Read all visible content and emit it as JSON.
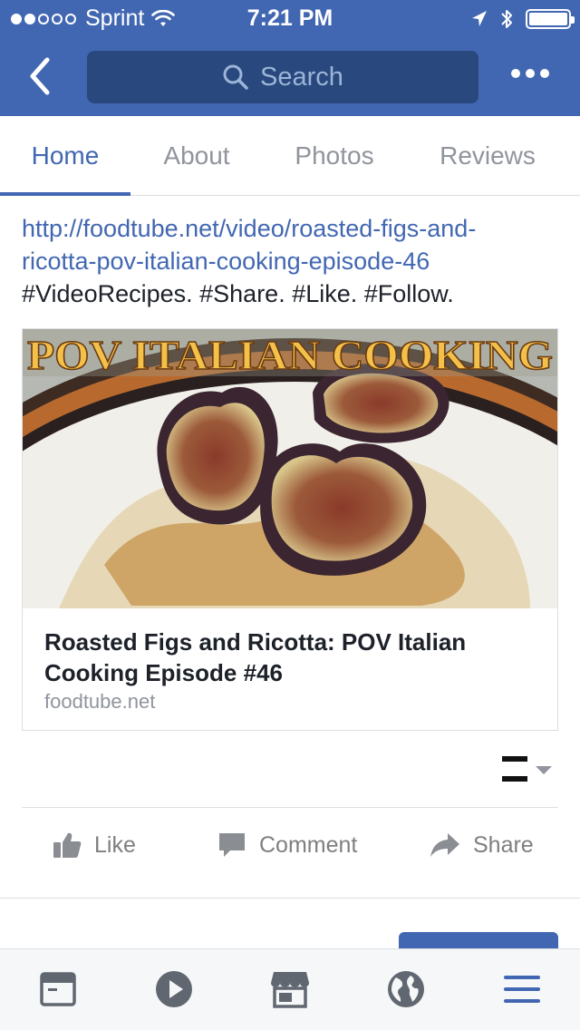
{
  "status_bar": {
    "carrier": "Sprint",
    "time": "7:21 PM",
    "signal_bars_filled": 2,
    "signal_bars_total": 5
  },
  "header": {
    "search_placeholder": "Search",
    "icons": [
      "back-arrow-icon",
      "search-icon",
      "more-dots-icon"
    ],
    "bar_color": "#4267b2",
    "search_bg_color": "#29487d"
  },
  "tabs": [
    {
      "label": "Home",
      "active": true
    },
    {
      "label": "About",
      "active": false
    },
    {
      "label": "Photos",
      "active": false
    },
    {
      "label": "Reviews",
      "active": false
    }
  ],
  "post": {
    "link_line1": "http://foodtube.net/video/roasted-figs-and-",
    "link_line2": "ricotta-pov-italian-cooking-episode-46",
    "tags": "#VideoRecipes. #Share. #Like. #Follow.",
    "card": {
      "image_banner": "POV ITALIAN COOKING",
      "title": "Roasted Figs and Ricotta: POV Italian Cooking Episode #46",
      "domain": "foodtube.net"
    },
    "actions": [
      {
        "label": "Like",
        "icon": "thumbs-up-icon"
      },
      {
        "label": "Comment",
        "icon": "comment-icon"
      },
      {
        "label": "Share",
        "icon": "share-arrow-icon"
      }
    ]
  },
  "bottom_nav": {
    "items": [
      "news-feed-icon",
      "video-play-icon",
      "marketplace-icon",
      "globe-icon",
      "menu-icon"
    ],
    "active_color": "#4267b2",
    "inactive_color": "#606770"
  },
  "colors": {
    "link": "#4267b2",
    "muted_text": "#90949c"
  }
}
